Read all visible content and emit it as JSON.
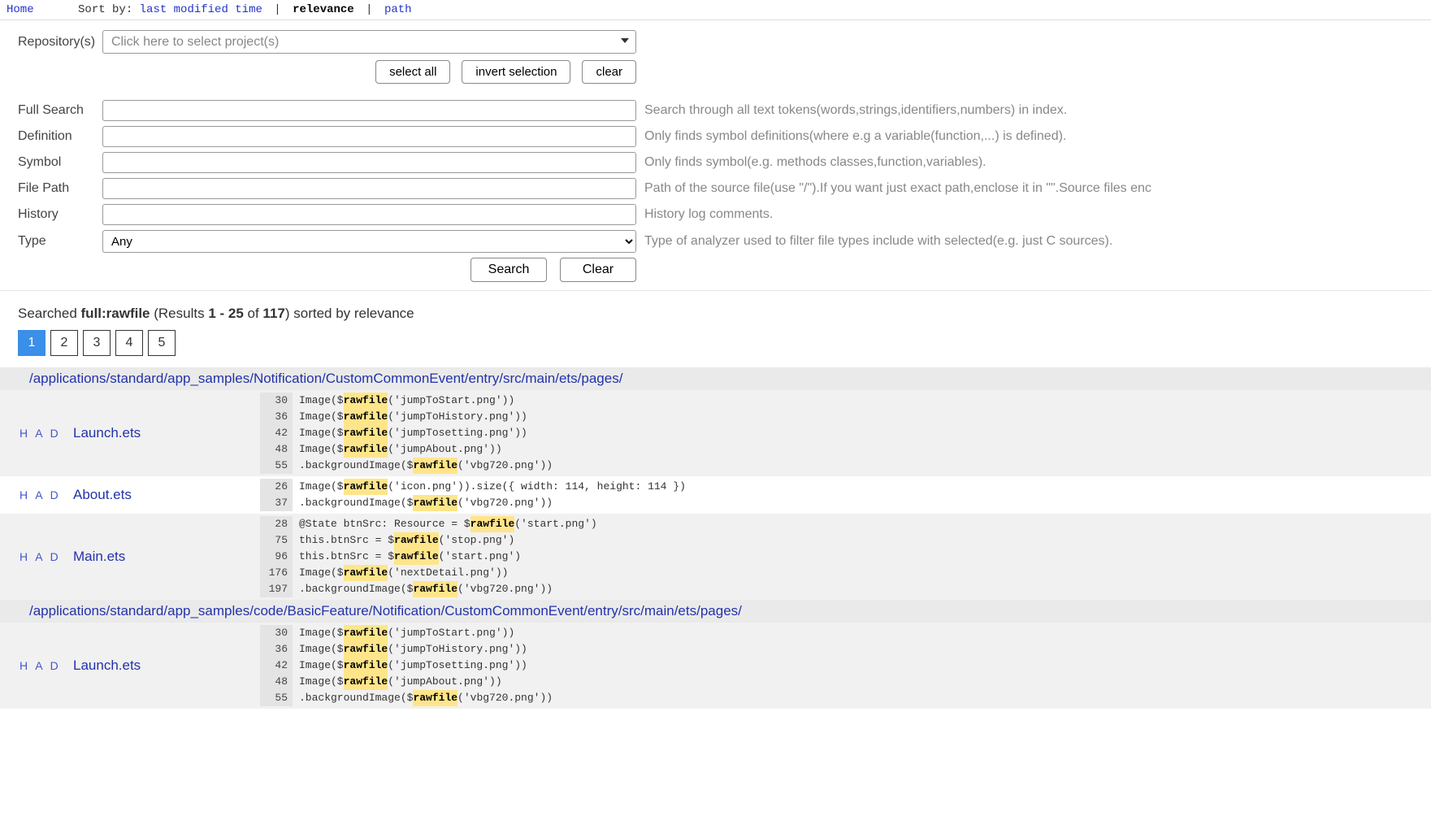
{
  "topbar": {
    "home": "Home",
    "sort_label": "Sort by:",
    "sort_options": [
      "last modified time",
      "relevance",
      "path"
    ],
    "sort_active_index": 1
  },
  "form": {
    "repo_label": "Repository(s)",
    "repo_placeholder": "Click here to select project(s)",
    "btn_select_all": "select all",
    "btn_invert": "invert selection",
    "btn_clear_sel": "clear",
    "rows": [
      {
        "label": "Full Search",
        "hint": "Search through all text tokens(words,strings,identifiers,numbers) in index."
      },
      {
        "label": "Definition",
        "hint": "Only finds symbol definitions(where e.g a variable(function,...) is defined)."
      },
      {
        "label": "Symbol",
        "hint": "Only finds symbol(e.g. methods classes,function,variables)."
      },
      {
        "label": "File Path",
        "hint": "Path of the source file(use \"/\").If you want just exact path,enclose it in \"\".Source files enc"
      },
      {
        "label": "History",
        "hint": "History log comments."
      }
    ],
    "type_label": "Type",
    "type_value": "Any",
    "type_hint": "Type of analyzer used to filter file types include with selected(e.g. just C sources).",
    "btn_search": "Search",
    "btn_clear": "Clear"
  },
  "summary": {
    "prefix": "Searched ",
    "query": "full:rawfile",
    "open": " (Results ",
    "range": "1 - 25",
    "of": " of ",
    "total": "117",
    "close": ") sorted by relevance"
  },
  "pages": [
    "1",
    "2",
    "3",
    "4",
    "5"
  ],
  "active_page": 0,
  "had": "H A D",
  "highlight": "rawfile",
  "groups": [
    {
      "dir": "/applications/standard/app_samples/Notification/CustomCommonEvent/entry/src/main/ets/pages/",
      "files": [
        {
          "name": "Launch.ets",
          "alt": true,
          "lines": [
            {
              "n": "30",
              "pre": "Image($",
              "post": "('jumpToStart.png'))"
            },
            {
              "n": "36",
              "pre": "Image($",
              "post": "('jumpToHistory.png'))"
            },
            {
              "n": "42",
              "pre": "Image($",
              "post": "('jumpTosetting.png'))"
            },
            {
              "n": "48",
              "pre": "Image($",
              "post": "('jumpAbout.png'))"
            },
            {
              "n": "55",
              "pre": ".backgroundImage($",
              "post": "('vbg720.png'))"
            }
          ]
        },
        {
          "name": "About.ets",
          "alt": false,
          "lines": [
            {
              "n": "26",
              "pre": "Image($",
              "post": "('icon.png')).size({ width: 114, height: 114 })"
            },
            {
              "n": "37",
              "pre": ".backgroundImage($",
              "post": "('vbg720.png'))"
            }
          ]
        },
        {
          "name": "Main.ets",
          "alt": true,
          "lines": [
            {
              "n": "28",
              "pre": "@State btnSrc: Resource = $",
              "post": "('start.png')"
            },
            {
              "n": "75",
              "pre": "this.btnSrc = $",
              "post": "('stop.png')"
            },
            {
              "n": "96",
              "pre": "this.btnSrc = $",
              "post": "('start.png')"
            },
            {
              "n": "176",
              "pre": "Image($",
              "post": "('nextDetail.png'))"
            },
            {
              "n": "197",
              "pre": ".backgroundImage($",
              "post": "('vbg720.png'))"
            }
          ]
        }
      ]
    },
    {
      "dir": "/applications/standard/app_samples/code/BasicFeature/Notification/CustomCommonEvent/entry/src/main/ets/pages/",
      "files": [
        {
          "name": "Launch.ets",
          "alt": true,
          "lines": [
            {
              "n": "30",
              "pre": "Image($",
              "post": "('jumpToStart.png'))"
            },
            {
              "n": "36",
              "pre": "Image($",
              "post": "('jumpToHistory.png'))"
            },
            {
              "n": "42",
              "pre": "Image($",
              "post": "('jumpTosetting.png'))"
            },
            {
              "n": "48",
              "pre": "Image($",
              "post": "('jumpAbout.png'))"
            },
            {
              "n": "55",
              "pre": ".backgroundImage($",
              "post": "('vbg720.png'))"
            }
          ]
        }
      ]
    }
  ]
}
